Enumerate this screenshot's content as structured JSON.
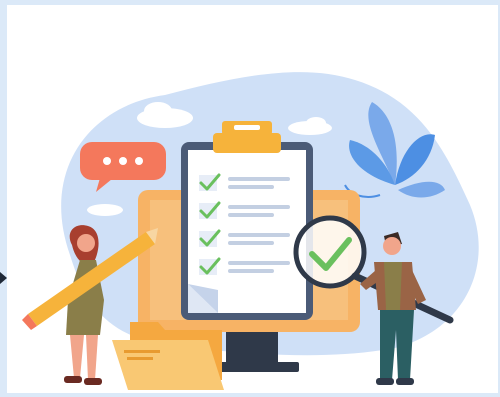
{
  "illustration": {
    "subject": "checklist-review",
    "checklist_items": [
      {
        "checked": true
      },
      {
        "checked": true
      },
      {
        "checked": true
      },
      {
        "checked": true
      }
    ],
    "colors": {
      "background_blob": "#cfe0f7",
      "monitor_frame": "#f7b365",
      "monitor_stand": "#2f3949",
      "clipboard_border": "#4b5b77",
      "clip": "#f6b33b",
      "check_green": "#6ac05e",
      "speech_bubble": "#f4785c",
      "leaf_blue": "#4d8fe3",
      "folder": "#f5a840"
    }
  }
}
